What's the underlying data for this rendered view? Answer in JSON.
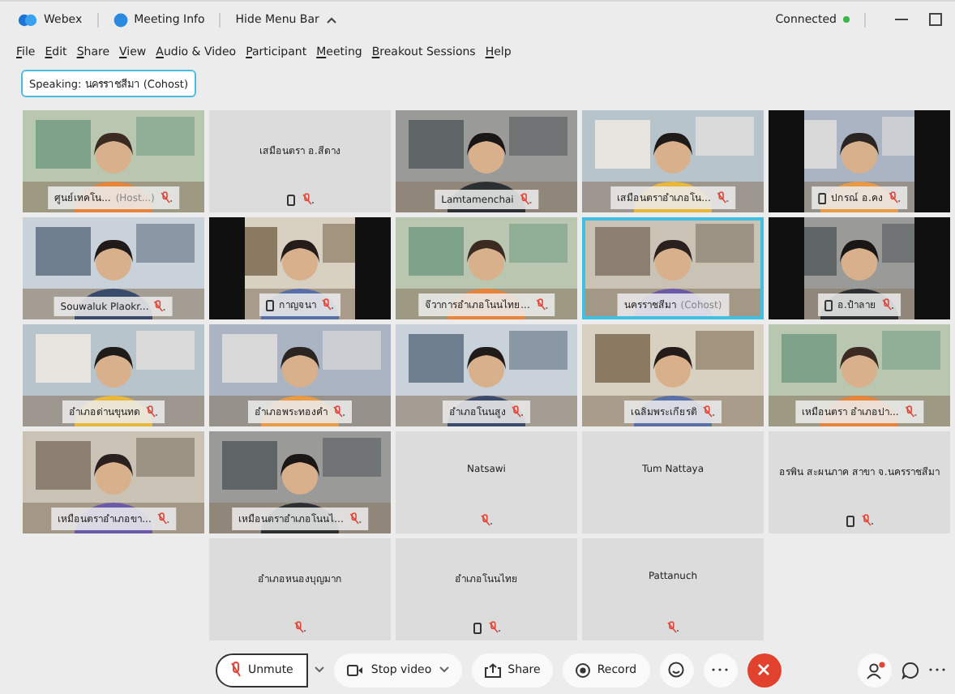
{
  "title_bar": {
    "app": "Webex",
    "meeting_info": "Meeting Info",
    "hide_menu": "Hide Menu Bar",
    "status": "Connected"
  },
  "menu": [
    "File",
    "Edit",
    "Share",
    "View",
    "Audio & Video",
    "Participant",
    "Meeting",
    "Breakout Sessions",
    "Help"
  ],
  "speaking": "Speaking: นครราชสีมา (Cohost)",
  "tiles": [
    {
      "kind": "video",
      "name": "ศูนย์เทคโน...",
      "role": "(Host...)",
      "phone": false,
      "muted": true,
      "selected": false
    },
    {
      "kind": "audio",
      "name": "เสมือนตรา อ.สีดาง",
      "phone": true,
      "muted": true,
      "selected": false
    },
    {
      "kind": "video",
      "name": "Lamtamenchai",
      "phone": false,
      "muted": true,
      "selected": false
    },
    {
      "kind": "video",
      "name": "เสมือนตราอำเภอโน...",
      "phone": false,
      "muted": true,
      "selected": false
    },
    {
      "kind": "video",
      "name": "ปกรณ์ อ.คง",
      "phone": true,
      "muted": true,
      "selected": false
    },
    {
      "kind": "video",
      "name": "Souwaluk Plaokr...",
      "phone": false,
      "muted": true,
      "selected": false
    },
    {
      "kind": "video",
      "name": "กาญจนา",
      "phone": true,
      "muted": true,
      "selected": false
    },
    {
      "kind": "video",
      "name": "จีวาการอำเภอโนนไทย...",
      "phone": false,
      "muted": true,
      "selected": false
    },
    {
      "kind": "video",
      "name": "นครราชสีมา",
      "role": "(Cohost)",
      "phone": false,
      "muted": false,
      "selected": true
    },
    {
      "kind": "video",
      "name": "อ.ปำลาย",
      "phone": true,
      "muted": true,
      "selected": false
    },
    {
      "kind": "video",
      "name": "อำเภอด่านขุนทด",
      "phone": false,
      "muted": true,
      "selected": false
    },
    {
      "kind": "video",
      "name": "อำเภอพระทองคำ",
      "phone": false,
      "muted": true,
      "selected": false
    },
    {
      "kind": "video",
      "name": "อำเภอโนนสูง",
      "phone": false,
      "muted": true,
      "selected": false
    },
    {
      "kind": "video",
      "name": "เฉลิมพระเกียรติ",
      "phone": false,
      "muted": true,
      "selected": false
    },
    {
      "kind": "video",
      "name": "เหมือนตรา อำเภอปา...",
      "phone": false,
      "muted": true,
      "selected": false
    },
    {
      "kind": "video",
      "name": "เหมือนตราอำเภอขา...",
      "phone": false,
      "muted": true,
      "selected": false
    },
    {
      "kind": "video",
      "name": "เหมือนตราอำเภอโนนไ...",
      "phone": false,
      "muted": true,
      "selected": false
    },
    {
      "kind": "audio",
      "name": "Natsawi",
      "phone": false,
      "muted": true,
      "selected": false
    },
    {
      "kind": "audio",
      "name": "Tum Nattaya",
      "phone": false,
      "muted": false,
      "selected": false
    },
    {
      "kind": "audio",
      "name": "อรพิน สะผนภาค สาขา จ.นครราชสีมา",
      "phone": true,
      "muted": true,
      "selected": false
    },
    {
      "kind": "audio",
      "name": "อำเภอหนองบุญมาก",
      "phone": false,
      "muted": true,
      "selected": false
    },
    {
      "kind": "audio",
      "name": "อำเภอโนนไทย",
      "phone": true,
      "muted": true,
      "selected": false
    },
    {
      "kind": "audio",
      "name": "Pattanuch",
      "phone": false,
      "muted": true,
      "selected": false
    }
  ],
  "controls": {
    "unmute": "Unmute",
    "stop_video": "Stop video",
    "share": "Share",
    "record": "Record"
  }
}
